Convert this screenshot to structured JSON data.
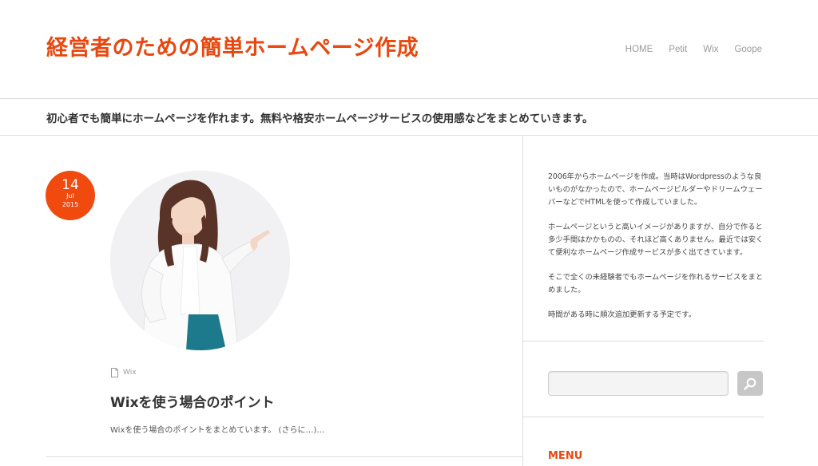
{
  "header": {
    "site_title": "経営者のための簡単ホームページ作成",
    "tagline": "初心者でも簡単にホームページを作れます。無料や格安ホームページサービスの使用感などをまとめていきます。"
  },
  "nav": {
    "items": [
      {
        "label": "HOME"
      },
      {
        "label": "Petit"
      },
      {
        "label": "Wix"
      },
      {
        "label": "Goope"
      }
    ]
  },
  "post": {
    "date": {
      "day": "14",
      "month": "Jul",
      "year": "2015"
    },
    "category": "Wix",
    "category_icon": "document-icon",
    "title": "Wixを使う場合のポイント",
    "excerpt": "Wixを使う場合のポイントをまとめています。 (さらに…)…"
  },
  "sidebar": {
    "about_paragraphs": [
      "2006年からホームページを作成。当時はWordpressのような良いものがなかったので、ホームページビルダーやドリームウェーバーなどでHTMLを使って作成していました。",
      "ホームページというと高いイメージがありますが、自分で作ると多少手間はかかものの、それほど高くありません。最近では安くて便利なホームページ作成サービスが多く出てきています。",
      "そこで全くの未経験者でもホームページを作れるサービスをまとめました。",
      "時間がある時に順次追加更新する予定です。"
    ],
    "search": {
      "placeholder": "",
      "button_icon": "search-icon"
    },
    "menu_title": "MENU"
  },
  "colors": {
    "accent": "#e8480f",
    "badge": "#f04a0f",
    "nav_text": "#9a9a9a"
  }
}
